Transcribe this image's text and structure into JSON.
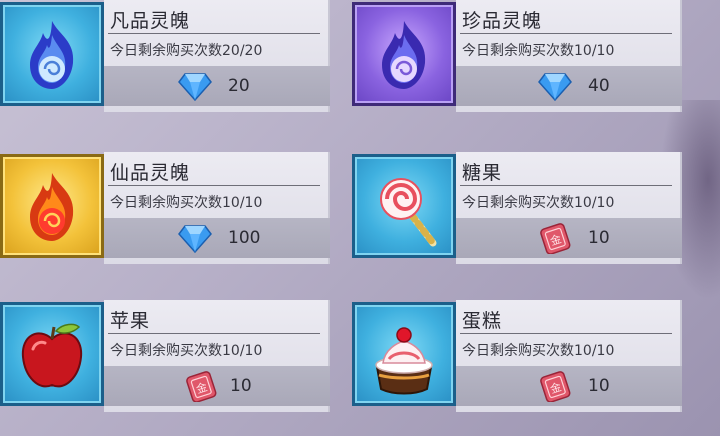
{
  "items": [
    {
      "name": "凡品灵魄",
      "limit": "今日剩余购买次数20/20",
      "price": "20",
      "currency": "diamond-icon",
      "icon": "blue-soul-flame-icon",
      "frame": "blue"
    },
    {
      "name": "珍品灵魄",
      "limit": "今日剩余购买次数10/10",
      "price": "40",
      "currency": "diamond-icon",
      "icon": "purple-soul-flame-icon",
      "frame": "purple"
    },
    {
      "name": "仙品灵魄",
      "limit": "今日剩余购买次数10/10",
      "price": "100",
      "currency": "diamond-icon",
      "icon": "gold-soul-flame-icon",
      "frame": "gold"
    },
    {
      "name": "糖果",
      "limit": "今日剩余购买次数10/10",
      "price": "10",
      "currency": "coupon-icon",
      "icon": "lollipop-icon",
      "frame": "blue"
    },
    {
      "name": "苹果",
      "limit": "今日剩余购买次数10/10",
      "price": "10",
      "currency": "coupon-icon",
      "icon": "apple-icon",
      "frame": "blue"
    },
    {
      "name": "蛋糕",
      "limit": "今日剩余购买次数10/10",
      "price": "10",
      "currency": "coupon-icon",
      "icon": "cake-icon",
      "frame": "blue"
    }
  ]
}
